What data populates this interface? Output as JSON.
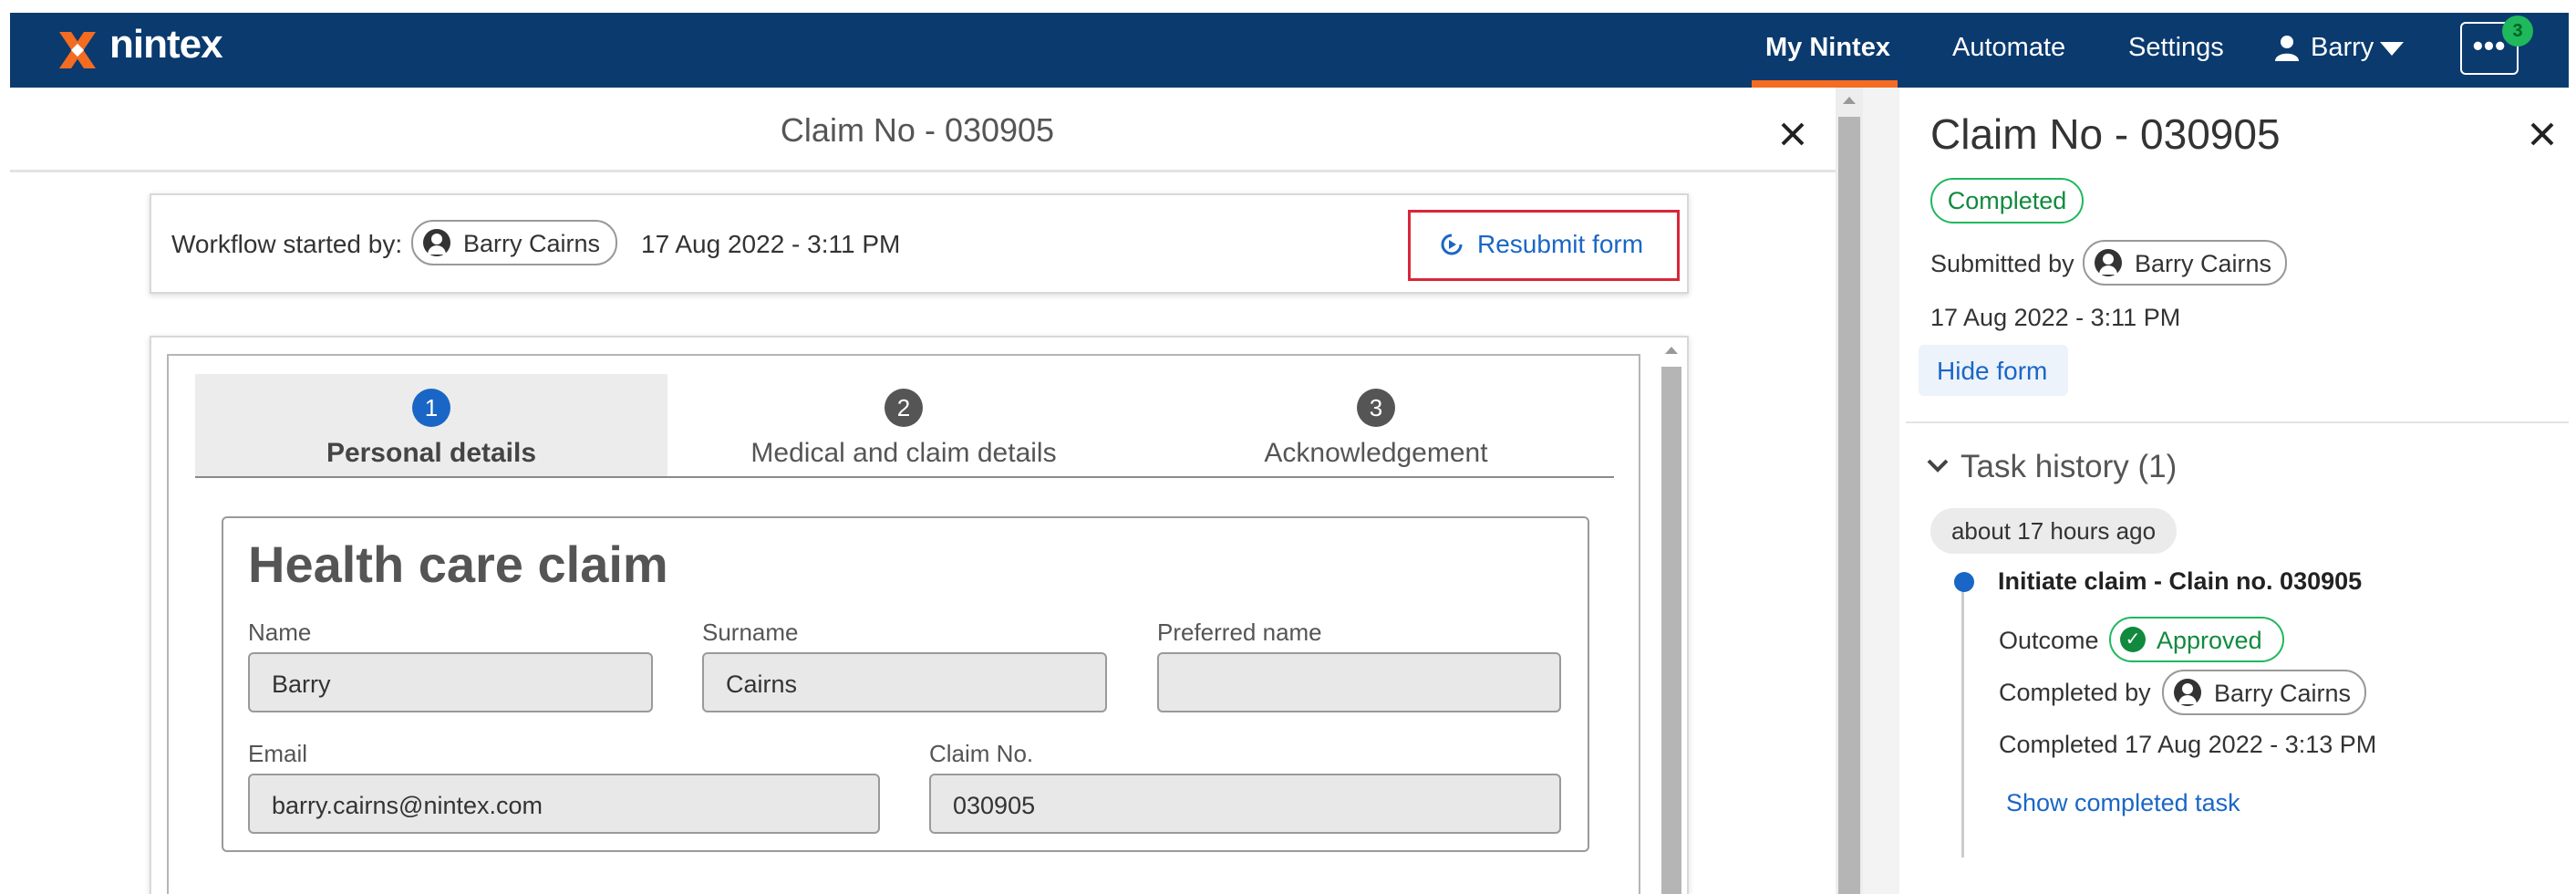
{
  "app": {
    "brand": "nintex",
    "brand_color": "#0a3a6e",
    "accent_color": "#f36c21",
    "nav": {
      "my_nintex": "My Nintex",
      "automate": "Automate",
      "settings": "Settings",
      "user": "Barry",
      "more_icon": "ellipsis-icon",
      "notification_count": "3"
    }
  },
  "modal": {
    "title": "Claim No - 030905",
    "close_icon": "close-icon",
    "workflow": {
      "label": "Workflow started by:",
      "user": "Barry Cairns",
      "date": "17 Aug 2022 - 3:11 PM",
      "resubmit": "Resubmit form"
    },
    "steps": [
      {
        "number": "1",
        "label": "Personal details"
      },
      {
        "number": "2",
        "label": "Medical and claim details"
      },
      {
        "number": "3",
        "label": "Acknowledgement"
      }
    ],
    "form": {
      "title": "Health care claim",
      "name_label": "Name",
      "name_value": "Barry",
      "surname_label": "Surname",
      "surname_value": "Cairns",
      "preferred_label": "Preferred name",
      "preferred_value": "",
      "email_label": "Email",
      "email_value": "barry.cairns@nintex.com",
      "claim_label": "Claim No.",
      "claim_value": "030905"
    }
  },
  "panel": {
    "title": "Claim No - 030905",
    "status": "Completed",
    "submitted_by_label": "Submitted by",
    "submitted_by_user": "Barry Cairns",
    "date": "17 Aug 2022 - 3:11 PM",
    "hide_form": "Hide form",
    "task_history": "Task history (1)",
    "ago": "about 17 hours ago",
    "task": {
      "title": "Initiate claim - Clain no. 030905",
      "outcome_label": "Outcome",
      "outcome_value": "Approved",
      "completed_by_label": "Completed by",
      "completed_by_user": "Barry Cairns",
      "completed_text": "Completed 17 Aug 2022 - 3:13 PM",
      "show_task": "Show completed task"
    }
  }
}
